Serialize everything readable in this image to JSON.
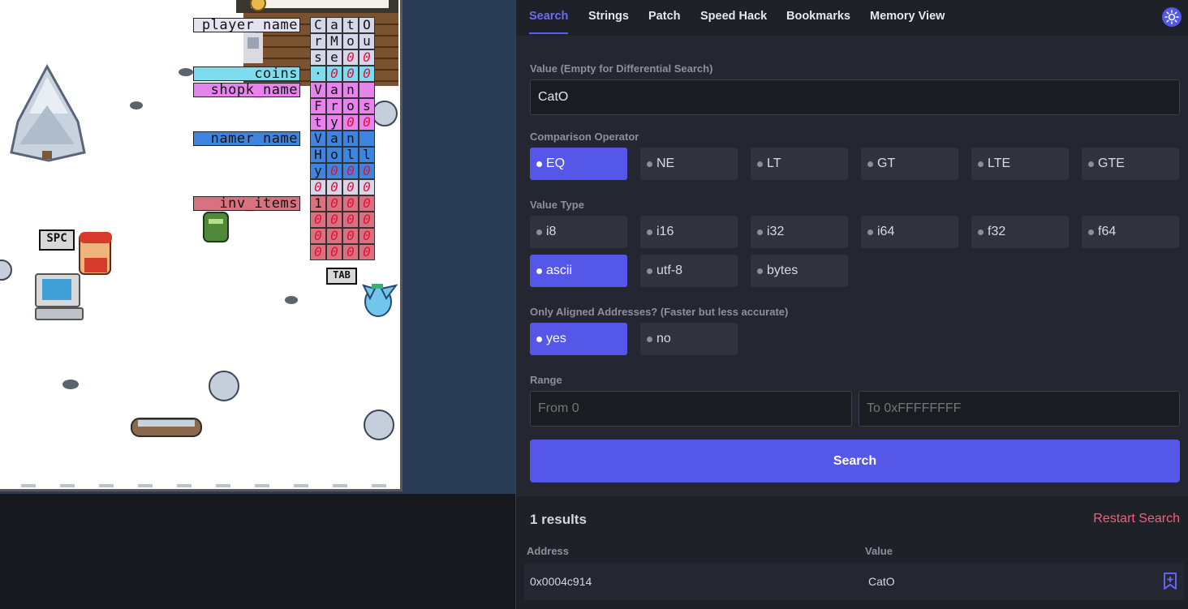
{
  "game": {
    "labels": {
      "player_name": "player_name",
      "coins": "coins",
      "shopk_name": "shopk_name",
      "namer_name": "namer_name",
      "inv_items": "inv_items"
    },
    "memory_rows": [
      [
        "C",
        "a",
        "t",
        "O"
      ],
      [
        "r",
        "M",
        "o",
        "u"
      ],
      [
        "s",
        "e",
        "0",
        "0"
      ],
      [
        "·",
        "0",
        "0",
        "0"
      ],
      [
        "V",
        "a",
        "n",
        ""
      ],
      [
        "F",
        "r",
        "o",
        "s"
      ],
      [
        "t",
        "y",
        "0",
        "0"
      ],
      [
        "V",
        "a",
        "n",
        ""
      ],
      [
        "H",
        "o",
        "l",
        "l"
      ],
      [
        "y",
        "0",
        "0",
        "0"
      ],
      [
        "0",
        "0",
        "0",
        "0"
      ],
      [
        "1",
        "0",
        "0",
        "0"
      ],
      [
        "0",
        "0",
        "0",
        "0"
      ],
      [
        "0",
        "0",
        "0",
        "0"
      ],
      [
        "0",
        "0",
        "0",
        "0"
      ]
    ],
    "key_spc": "SPC",
    "key_tab": "TAB"
  },
  "tabs": [
    {
      "label": "Search",
      "active": true
    },
    {
      "label": "Strings"
    },
    {
      "label": "Patch"
    },
    {
      "label": "Speed Hack"
    },
    {
      "label": "Bookmarks"
    },
    {
      "label": "Memory View"
    }
  ],
  "theme_icon": "sun-icon",
  "search": {
    "value_label": "Value (Empty for Differential Search)",
    "value": "CatO",
    "comparison_label": "Comparison Operator",
    "comparison_options": [
      "EQ",
      "NE",
      "LT",
      "GT",
      "LTE",
      "GTE"
    ],
    "comparison_selected": "EQ",
    "type_label": "Value Type",
    "type_options": [
      "i8",
      "i16",
      "i32",
      "i64",
      "f32",
      "f64",
      "ascii",
      "utf-8",
      "bytes"
    ],
    "type_selected": "ascii",
    "aligned_label": "Only Aligned Addresses? (Faster but less accurate)",
    "aligned_options": [
      "yes",
      "no"
    ],
    "aligned_selected": "yes",
    "range_label": "Range",
    "range_from_placeholder": "From 0",
    "range_to_placeholder": "To 0xFFFFFFFF",
    "button_label": "Search"
  },
  "results": {
    "count_text": "1 results",
    "restart_label": "Restart Search",
    "col_address": "Address",
    "col_value": "Value",
    "rows": [
      {
        "address": "0x0004c914",
        "value": "CatO"
      }
    ]
  },
  "colors": {
    "accent": "#5557e8",
    "restart": "#f0607d",
    "player_name_bg": "#e3e3f2",
    "coins_bg": "#7fdcef",
    "shopk_bg": "#e683ec",
    "namer_bg": "#3f85e0",
    "inv_bg": "#d9727f"
  }
}
